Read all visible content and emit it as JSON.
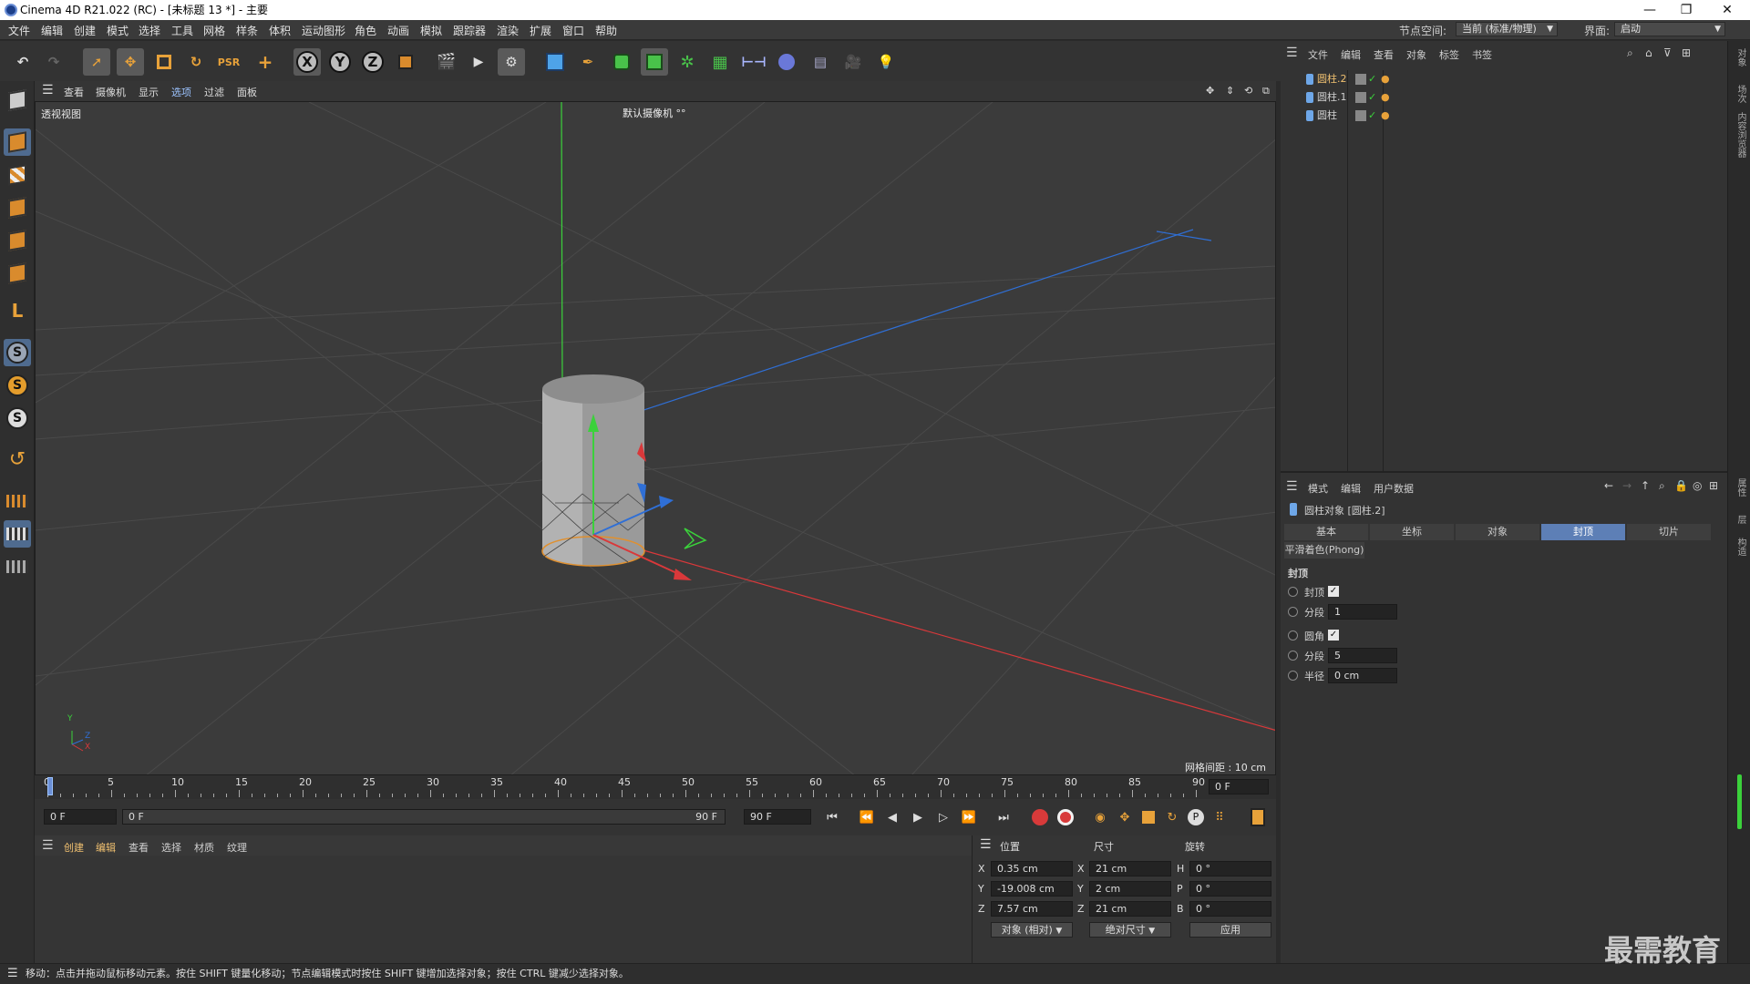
{
  "titlebar": {
    "title": "Cinema 4D R21.022 (RC) - [未标题 13 *] - 主要",
    "minimize": "—",
    "restore": "❐",
    "close": "✕"
  },
  "menubar": {
    "items": [
      "文件",
      "编辑",
      "创建",
      "模式",
      "选择",
      "工具",
      "网格",
      "样条",
      "体积",
      "运动图形",
      "角色",
      "动画",
      "模拟",
      "跟踪器",
      "渲染",
      "扩展",
      "窗口",
      "帮助"
    ],
    "node_space_label": "节点空间:",
    "node_space_value": "当前 (标准/物理)",
    "layout_label": "界面:",
    "layout_value": "启动"
  },
  "viewport_menu": {
    "items": [
      "查看",
      "摄像机",
      "显示",
      "选项",
      "过滤",
      "面板"
    ]
  },
  "viewport": {
    "view_name": "透视视图",
    "camera_label": "默认摄像机 °°",
    "grid_spacing": "网格间距 : 10 cm",
    "axis_x": "X",
    "axis_y": "Y",
    "axis_z": "Z"
  },
  "timeline": {
    "ticks": [
      "0",
      "5",
      "10",
      "15",
      "20",
      "25",
      "30",
      "35",
      "40",
      "45",
      "50",
      "55",
      "60",
      "65",
      "70",
      "75",
      "80",
      "85",
      "90"
    ],
    "current_frame": "0 F",
    "start_frame": "0 F",
    "range_start": "0 F",
    "range_end": "90 F",
    "end_frame": "90 F"
  },
  "material_menu": {
    "items": [
      "创建",
      "编辑",
      "查看",
      "选择",
      "材质",
      "纹理"
    ]
  },
  "coordinates": {
    "headers": {
      "position": "位置",
      "size": "尺寸",
      "rotation": "旋转"
    },
    "pos": {
      "x": "0.35 cm",
      "y": "-19.008 cm",
      "z": "7.57 cm"
    },
    "size": {
      "x": "21 cm",
      "y": "2 cm",
      "z": "21 cm"
    },
    "rot": {
      "h": "0 °",
      "p": "0 °",
      "b": "0 °"
    },
    "labels": {
      "x": "X",
      "y": "Y",
      "z": "Z",
      "h": "H",
      "p": "P",
      "b": "B"
    },
    "mode_dropdown": "对象 (相对)",
    "size_dropdown": "绝对尺寸",
    "apply": "应用"
  },
  "object_manager": {
    "menu": [
      "文件",
      "编辑",
      "查看",
      "对象",
      "标签",
      "书签"
    ],
    "objects": [
      {
        "name": "圆柱.2",
        "selected": true
      },
      {
        "name": "圆柱.1",
        "selected": false
      },
      {
        "name": "圆柱",
        "selected": false
      }
    ]
  },
  "attribute_manager": {
    "menu": [
      "模式",
      "编辑",
      "用户数据"
    ],
    "object_title": "圆柱对象 [圆柱.2]",
    "tabs": [
      "基本",
      "坐标",
      "对象",
      "封顶",
      "切片"
    ],
    "active_tab": "封顶",
    "phong_tab": "平滑着色(Phong)",
    "section": "封顶",
    "params": [
      {
        "label": "封顶",
        "type": "check",
        "value": "✓"
      },
      {
        "label": "分段",
        "type": "field",
        "value": "1"
      },
      {
        "label": "圆角",
        "type": "check",
        "value": "✓"
      },
      {
        "label": "分段",
        "type": "field",
        "value": "5"
      },
      {
        "label": "半径",
        "type": "field",
        "value": "0 cm"
      }
    ]
  },
  "right_strip": {
    "tabs": [
      "对象",
      "场次",
      "内容浏览器",
      "属性",
      "层",
      "构造"
    ]
  },
  "status": {
    "text": "移动：点击并拖动鼠标移动元素。按住 SHIFT 键量化移动；节点编辑模式时按住 SHIFT 键增加选择对象；按住 CTRL 键减少选择对象。"
  },
  "watermark": "最需教育",
  "colors": {
    "accent": "#5d7fb6",
    "axis_x": "#d9383a",
    "axis_y": "#3bd13b",
    "axis_z": "#2f6fd6",
    "selection": "#e0902f"
  }
}
